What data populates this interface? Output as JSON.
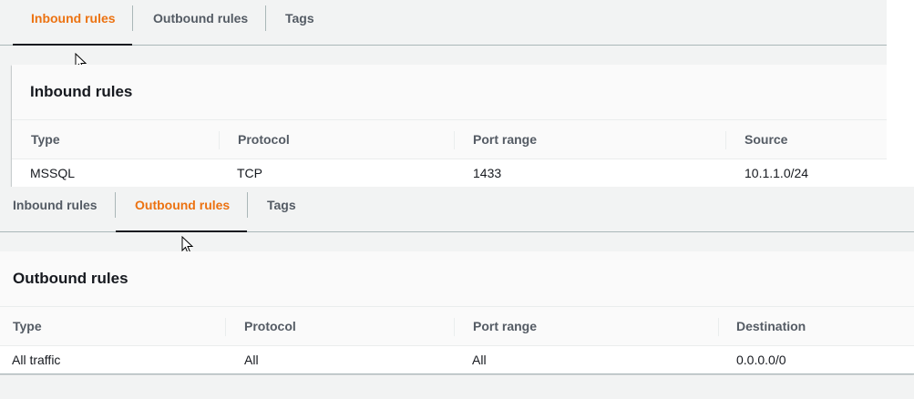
{
  "inbound_panel": {
    "tabs": [
      {
        "label": "Inbound rules",
        "active": true
      },
      {
        "label": "Outbound rules",
        "active": false
      },
      {
        "label": "Tags",
        "active": false
      }
    ],
    "card_title": "Inbound rules",
    "columns": [
      "Type",
      "Protocol",
      "Port range",
      "Source"
    ],
    "rows": [
      [
        "MSSQL",
        "TCP",
        "1433",
        "10.1.1.0/24"
      ]
    ]
  },
  "outbound_panel": {
    "tabs": [
      {
        "label": "Inbound rules",
        "active": false
      },
      {
        "label": "Outbound rules",
        "active": true
      },
      {
        "label": "Tags",
        "active": false
      }
    ],
    "card_title": "Outbound rules",
    "columns": [
      "Type",
      "Protocol",
      "Port range",
      "Destination"
    ],
    "rows": [
      [
        "All traffic",
        "All",
        "All",
        "0.0.0.0/0"
      ]
    ]
  },
  "colors": {
    "active_tab": "#ec7211",
    "inactive_tab": "#545b64",
    "text": "#16191f",
    "panel_bg": "#f2f3f3"
  },
  "icons": [
    "mouse-pointer-icon"
  ]
}
